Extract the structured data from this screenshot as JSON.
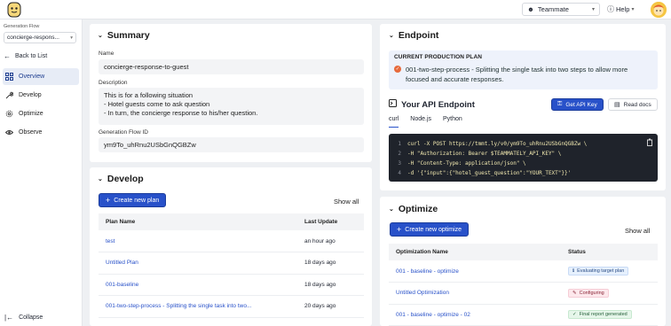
{
  "topbar": {
    "team_label": "Teammate",
    "help_label": "Help"
  },
  "sidebar": {
    "flow_label": "Generation Flow",
    "flow_value": "concierge-respons...",
    "back_label": "Back to List",
    "items": [
      {
        "label": "Overview",
        "icon": "grid-icon",
        "active": true
      },
      {
        "label": "Develop",
        "icon": "wrench-icon",
        "active": false
      },
      {
        "label": "Optimize",
        "icon": "gear-icon",
        "active": false
      },
      {
        "label": "Observe",
        "icon": "eye-icon",
        "active": false
      }
    ],
    "collapse_label": "Collapse"
  },
  "summary": {
    "title": "Summary",
    "name_label": "Name",
    "name_value": "concierge-response-to-guest",
    "description_label": "Description",
    "description_lines": [
      "This is for a following situation",
      "- Hotel guests come to ask question",
      "- In turn, the concierge response to his/her question."
    ],
    "id_label": "Generation Flow ID",
    "id_value": "ym9To_uhRnu2USbGnQGBZw"
  },
  "develop": {
    "title": "Develop",
    "create_label": "Create new plan",
    "show_all": "Show all",
    "columns": [
      "Plan Name",
      "Last Update"
    ],
    "rows": [
      {
        "name": "test",
        "updated": "an hour ago"
      },
      {
        "name": "Untitled Plan",
        "updated": "18 days ago"
      },
      {
        "name": "001-baseline",
        "updated": "18 days ago"
      },
      {
        "name": "001-two-step-process - Splitting the single task into two...",
        "updated": "20 days ago"
      }
    ]
  },
  "endpoint": {
    "title": "Endpoint",
    "plan_heading": "CURRENT PRODUCTION PLAN",
    "plan_desc": "001-two-step-process - Splitting the single task into two steps to allow more focused and accurate responses.",
    "api_title": "Your API Endpoint",
    "get_api_key": "Get API Key",
    "read_docs": "Read docs",
    "tabs": [
      "curl",
      "Node.js",
      "Python"
    ],
    "code_lines": [
      "curl -X POST https://tmmt.ly/v0/ym9To_uhRnu2USbGnQGBZw \\",
      "-H \"Authorization: Bearer $TEAMMATELY_API_KEY\" \\",
      "-H \"Content-Type: application/json\" \\",
      "-d '{\"input\":{\"hotel_guest_question\":\"YOUR_TEXT\"}}'"
    ]
  },
  "optimize": {
    "title": "Optimize",
    "create_label": "Create new optimize",
    "show_all": "Show all",
    "columns": [
      "Optimization Name",
      "Status"
    ],
    "rows": [
      {
        "name": "001 - baseline - optimize",
        "status": "Evaluating target plan",
        "status_color": "blue"
      },
      {
        "name": "Untitled Optimization",
        "status": "Configuring",
        "status_color": "pink"
      },
      {
        "name": "001 - baseline - optimize - 02",
        "status": "Final report generated",
        "status_color": "green"
      }
    ]
  },
  "colors": {
    "accent": "#2851c9",
    "background": "#eef0f3",
    "banner": "#eef2fb"
  }
}
